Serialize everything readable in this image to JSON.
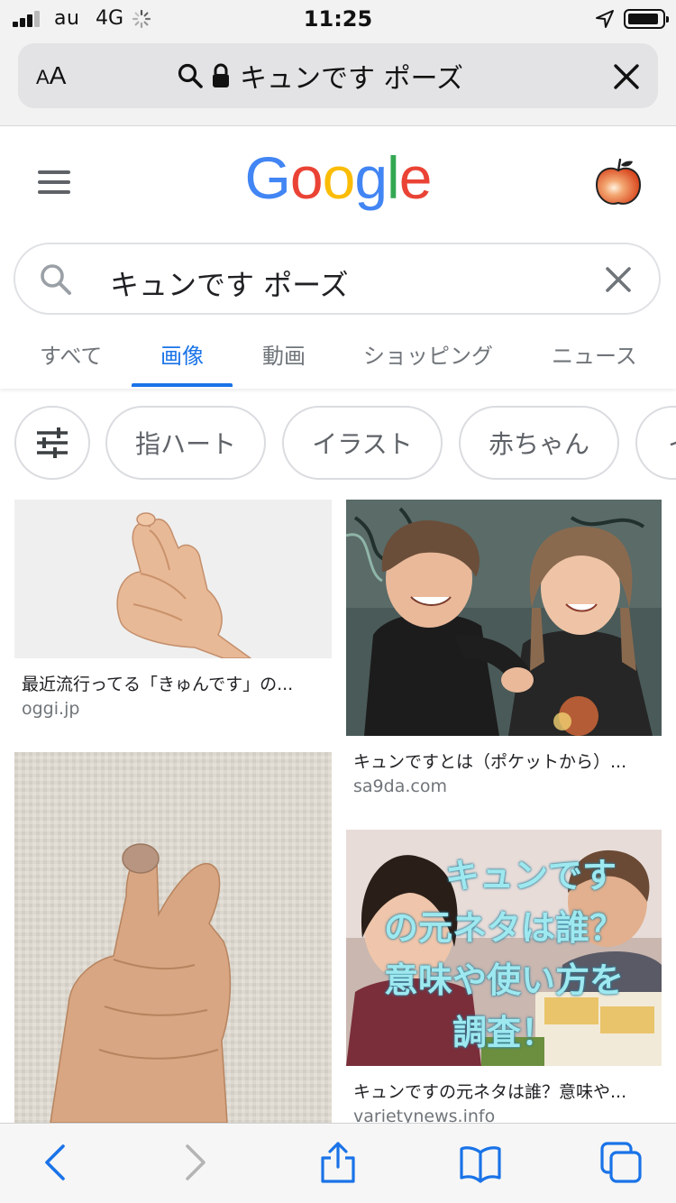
{
  "status_bar": {
    "carrier": "au",
    "network": "4G",
    "time": "11:25"
  },
  "safari": {
    "text_size_small": "A",
    "text_size_large": "A",
    "url": "キュンです ポーズ"
  },
  "google": {
    "logo_letters": [
      "G",
      "o",
      "o",
      "g",
      "l",
      "e"
    ],
    "logo_colors": [
      "#4285F4",
      "#EA4335",
      "#FBBC05",
      "#4285F4",
      "#34A853",
      "#EA4335"
    ],
    "search_query": "キュンです ポーズ",
    "tabs": [
      {
        "label": "すべて",
        "active": false
      },
      {
        "label": "画像",
        "active": true
      },
      {
        "label": "動画",
        "active": false
      },
      {
        "label": "ショッピング",
        "active": false
      },
      {
        "label": "ニュース",
        "active": false
      }
    ],
    "accent_color": "#1a73e8"
  },
  "chips": [
    "指ハート",
    "イラスト",
    "赤ちゃん",
    "イ"
  ],
  "results": [
    {
      "title": "最近流行ってる「きゅんです」の...",
      "source": "oggi.jp"
    },
    {
      "title": "キュンですとは（ポケットから）...",
      "source": "sa9da.com"
    },
    {
      "title": "キュンですの元ネタは誰？意味や...",
      "source": "varietynews.info"
    }
  ],
  "overlay_text": {
    "line1": "キュンです",
    "line2": "の元ネタは誰？",
    "line3": "意味や使い方を",
    "line4": "調査！"
  },
  "icons": {
    "status": [
      "signal-icon",
      "loading-icon",
      "location-arrow-icon",
      "battery-icon"
    ],
    "address_bar": [
      "search-icon",
      "lock-icon",
      "close-icon"
    ],
    "toolbar": [
      "back-icon",
      "forward-icon",
      "share-icon",
      "bookmarks-icon",
      "tabs-icon"
    ]
  }
}
